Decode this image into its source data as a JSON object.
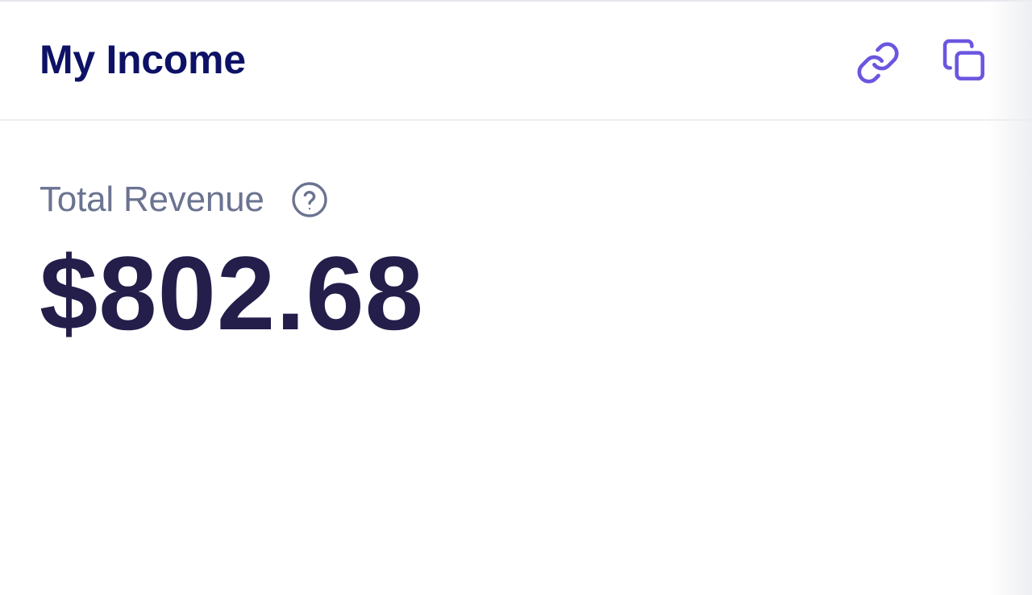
{
  "header": {
    "title": "My Income",
    "actions": [
      {
        "icon": "link-icon"
      },
      {
        "icon": "copy-icon"
      }
    ]
  },
  "revenue": {
    "label": "Total Revenue",
    "help_icon": "question-circle-icon",
    "amount": "$802.68"
  },
  "colors": {
    "title": "#0d1266",
    "label": "#6b7391",
    "amount": "#231e4a",
    "accent": "#6a56e0"
  }
}
